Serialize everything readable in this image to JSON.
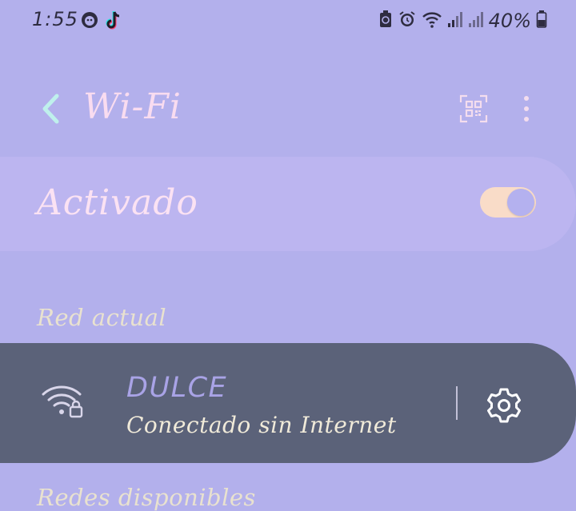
{
  "status_bar": {
    "time": "1:55",
    "battery": "40%",
    "left_icons": [
      "face-icon",
      "tiktok-icon"
    ],
    "right_icons": [
      "battery-saver-icon",
      "alarm-icon",
      "wifi-status-icon",
      "signal-icon",
      "signal-icon",
      "battery-icon"
    ]
  },
  "header": {
    "title": "Wi-Fi",
    "back_icon": "chevron-left-icon",
    "qr_icon": "qr-code-icon",
    "more_icon": "more-vertical-icon"
  },
  "wifi_toggle": {
    "label": "Activado",
    "on": true
  },
  "sections": {
    "current": "Red actual",
    "available": "Redes disponibles"
  },
  "current_network": {
    "name": "DULCE",
    "status": "Conectado sin Internet",
    "icon": "wifi-locked-icon",
    "settings_icon": "gear-icon"
  },
  "colors": {
    "background": "#b3b0ec",
    "toggle_card": "#bcb5f0",
    "network_card": "#5b6279",
    "title_pink": "#f9dcf0",
    "accent_teal": "#bff0ec",
    "toggle_track": "#f9dcc8",
    "network_name": "#a9a3e6"
  }
}
